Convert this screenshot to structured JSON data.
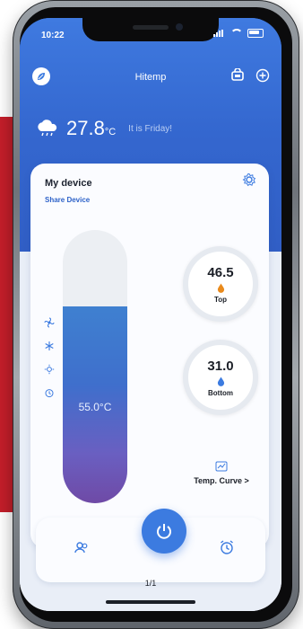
{
  "status": {
    "time": "10:22"
  },
  "header": {
    "title": "Hitemp"
  },
  "weather": {
    "temperature": "27.8",
    "unit": "°C",
    "message": "It is Friday!"
  },
  "device_card": {
    "title": "My device",
    "share_link": "Share Device",
    "tank_temperature": "55.0°C",
    "tank_fill_fraction": 0.72,
    "gauges": [
      {
        "value": "46.5",
        "label": "Top",
        "drop_color": "#e98a1c"
      },
      {
        "value": "31.0",
        "label": "Bottom",
        "drop_color": "#3c7be0"
      }
    ],
    "curve_label": "Temp. Curve >"
  },
  "bottom_nav": {
    "page_indicator": "1/1"
  },
  "colors": {
    "accent": "#3c7be0",
    "header": "#3467cf",
    "background": "#e9eef7"
  },
  "icons": {
    "app": "leaf-icon",
    "header_right": [
      "cart-icon",
      "add-icon"
    ],
    "weather": "cloud-rain-icon",
    "settings": "gear-icon",
    "side": [
      "fan-icon",
      "snowflake-icon",
      "sun-icon",
      "alarm-icon"
    ],
    "curve": "chart-icon",
    "nav": [
      "users-icon",
      "power-icon",
      "alarm-icon"
    ]
  }
}
